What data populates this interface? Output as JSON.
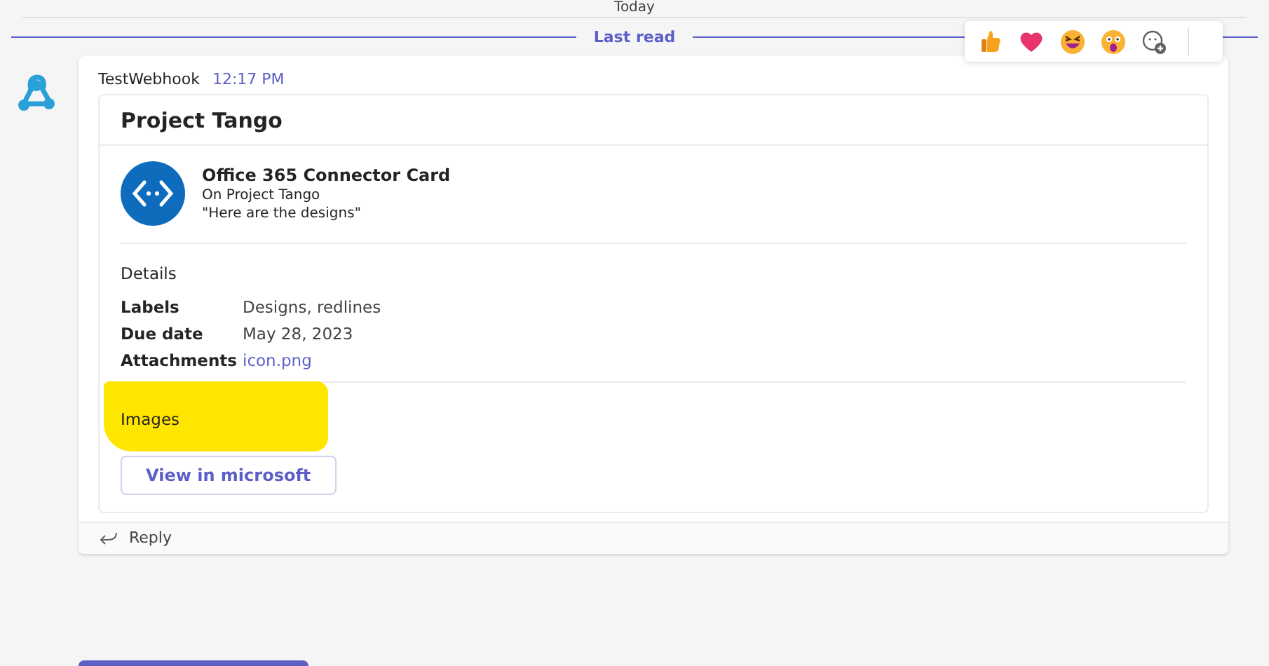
{
  "divider_top": {
    "label": "Today"
  },
  "divider_last_read": {
    "label": "Last read"
  },
  "reactions": [
    {
      "kind": "like"
    },
    {
      "kind": "heart"
    },
    {
      "kind": "laugh"
    },
    {
      "kind": "surprised"
    },
    {
      "kind": "add"
    }
  ],
  "message": {
    "sender": "TestWebhook",
    "time": "12:17 PM",
    "card": {
      "title": "Project Tango",
      "activity": {
        "title": "Office 365 Connector Card",
        "subtitle": "On Project Tango",
        "text": "\"Here are the designs\""
      },
      "section_title": "Details",
      "facts": [
        {
          "name": "Labels",
          "value": "Designs, redlines",
          "kind": "text"
        },
        {
          "name": "Due date",
          "value": "May 28, 2023",
          "kind": "text"
        },
        {
          "name": "Attachments",
          "value": "icon.png",
          "kind": "link"
        }
      ],
      "images_title": "Images",
      "action": "View in microsoft"
    },
    "reply": "Reply"
  }
}
